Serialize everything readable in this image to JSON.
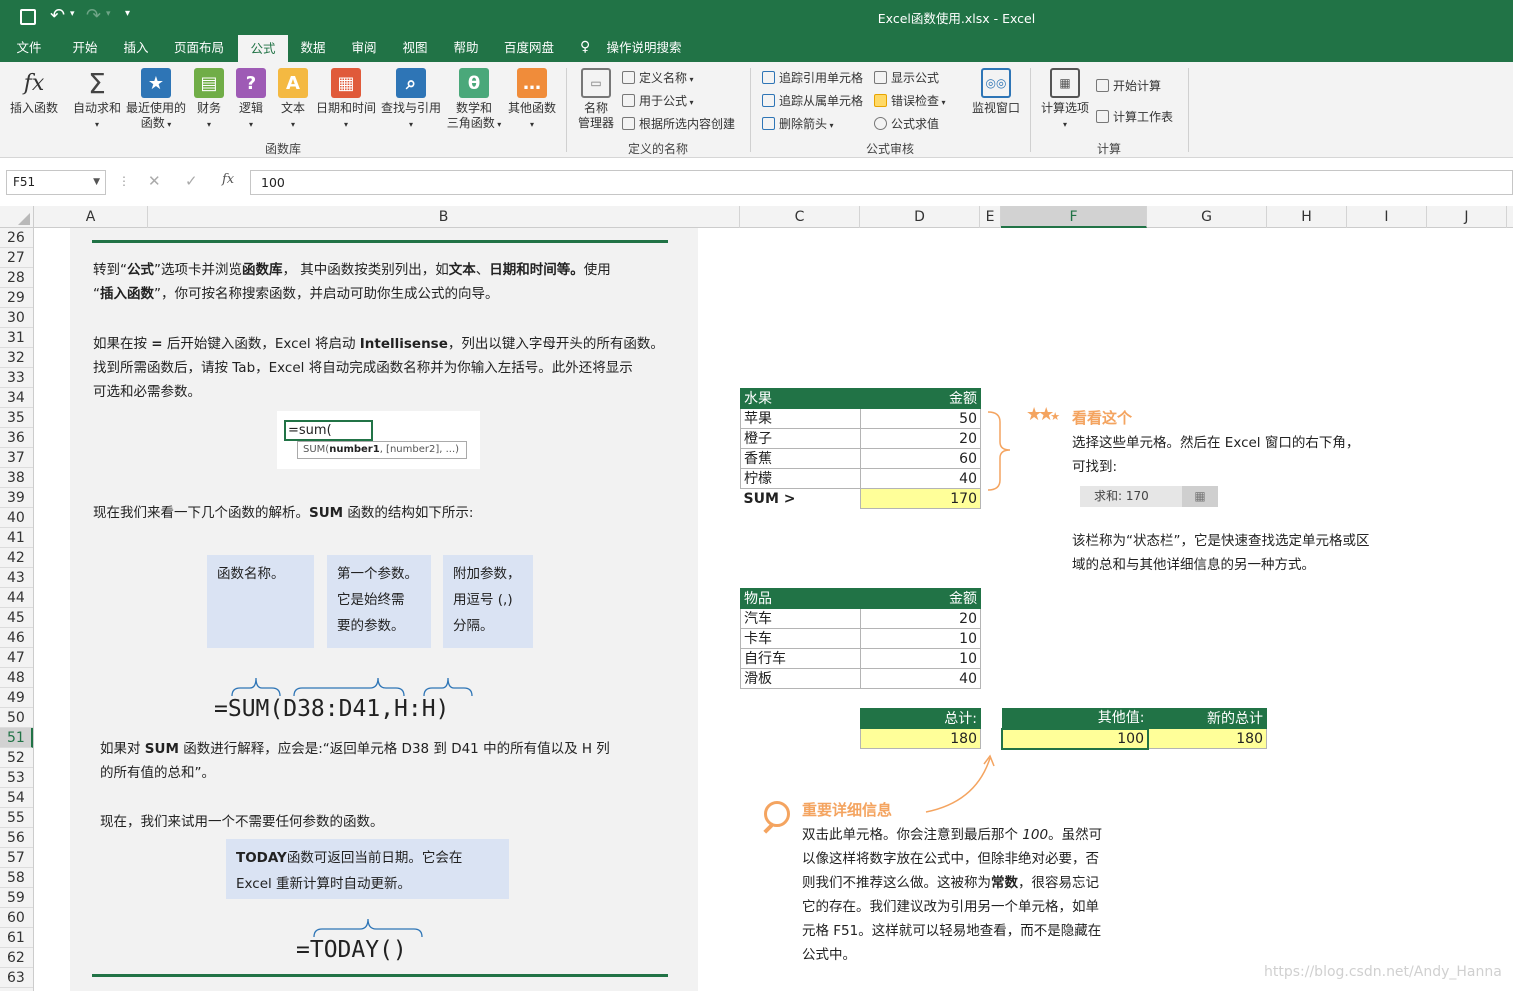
{
  "window": {
    "title": "Excel函数使用.xlsx  -  Excel"
  },
  "tabs": [
    {
      "label": "文件"
    },
    {
      "label": "开始"
    },
    {
      "label": "插入"
    },
    {
      "label": "页面布局"
    },
    {
      "label": "公式"
    },
    {
      "label": "数据"
    },
    {
      "label": "审阅"
    },
    {
      "label": "视图"
    },
    {
      "label": "帮助"
    },
    {
      "label": "百度网盘"
    },
    {
      "label": "操作说明搜索"
    }
  ],
  "ribbon": {
    "insert_function": "插入函数",
    "autosum": "自动求和",
    "recent_1": "最近使用的",
    "recent_2": "函数",
    "finance": "财务",
    "logic": "逻辑",
    "text": "文本",
    "datetime": "日期和时间",
    "lookup": "查找与引用",
    "math_1": "数学和",
    "math_2": "三角函数",
    "other": "其他函数",
    "group_library": "函数库",
    "name_mgr_1": "名称",
    "name_mgr_2": "管理器",
    "define_name": "定义名称",
    "use_in_formula": "用于公式",
    "create_from_sel": "根据所选内容创建",
    "group_names": "定义的名称",
    "trace_prec": "追踪引用单元格",
    "trace_dep": "追踪从属单元格",
    "remove_arrows": "删除箭头",
    "show_formulas": "显示公式",
    "error_check": "错误检查",
    "eval_formula": "公式求值",
    "watch": "监视窗口",
    "group_audit": "公式审核",
    "calc_options": "计算选项",
    "calc_now": "开始计算",
    "calc_sheet": "计算工作表",
    "group_calc": "计算"
  },
  "formula_bar": {
    "name_box": "F51",
    "fx": "fx",
    "value": "100"
  },
  "columns": [
    "A",
    "B",
    "C",
    "D",
    "E",
    "F",
    "G",
    "H",
    "I",
    "J"
  ],
  "rows": [
    "26",
    "27",
    "28",
    "29",
    "30",
    "31",
    "32",
    "33",
    "34",
    "35",
    "36",
    "37",
    "38",
    "39",
    "40",
    "41",
    "42",
    "43",
    "44",
    "45",
    "46",
    "47",
    "48",
    "49",
    "50",
    "51",
    "52",
    "53",
    "54",
    "55",
    "56",
    "57",
    "58",
    "59",
    "60",
    "61",
    "62",
    "63"
  ],
  "left": {
    "p1_a": "转到“",
    "p1_b": "公式",
    "p1_c": "”选项卡并浏览",
    "p1_d": "函数库",
    "p1_e": "，  其中函数按类别列出，如",
    "p1_f": "文本",
    "p1_g": "、",
    "p1_h": "日期和时间等。",
    "p1_i": "使用",
    "p1_j": "“",
    "p1_k": "插入函数",
    "p1_l": "”，你可按名称搜索函数，并启动可助你生成公式的向导。",
    "p2_a": "如果在按 ",
    "p2_b": "=",
    "p2_c": " 后开始键入函数，Excel 将启动 ",
    "p2_d": "Intellisense",
    "p2_e": "，列出以键入字母开头的所有函数。",
    "p2_f": "找到所需函数后，请按 Tab，Excel 将自动完成函数名称并为你输入左括号。此外还将显示",
    "p2_g": "可选和必需参数。",
    "ac_input": "=sum(",
    "ac_tip_a": "SUM(",
    "ac_tip_b": "number1",
    "ac_tip_c": ", [number2], ...)",
    "p3_a": "现在我们来看一下几个函数的解析。",
    "p3_b": "SUM",
    "p3_c": " 函数的结构如下所示:",
    "box1": "函数名称。",
    "box2_1": "第一个参数。",
    "box2_2": "它是始终需",
    "box2_3": "要的参数。",
    "box3_1": "附加参数，",
    "box3_2": "用逗号 (,)",
    "box3_3": "分隔。",
    "sum_formula": "=SUM(D38:D41,H:H)",
    "p4_a": "如果对 ",
    "p4_b": "SUM",
    "p4_c": " 函数进行解释，应会是:“返回单元格 D38 到 D41 中的所有值以及 H 列",
    "p4_d": "的所有值的总和”。",
    "p5": "现在，我们来试用一个不需要任何参数的函数。",
    "today_a": "TODAY",
    "today_b": "函数可返回当前日期。它会在",
    "today_c": "Excel 重新计算时自动更新。",
    "today_formula": "=TODAY()"
  },
  "fruit_table": {
    "header": [
      "水果",
      "金额"
    ],
    "rows": [
      [
        "苹果",
        "50"
      ],
      [
        "橙子",
        "20"
      ],
      [
        "香蕉",
        "60"
      ],
      [
        "柠檬",
        "40"
      ]
    ],
    "sum_label": "SUM >",
    "sum_value": "170"
  },
  "item_table": {
    "header": [
      "物品",
      "金额"
    ],
    "rows": [
      [
        "汽车",
        "20"
      ],
      [
        "卡车",
        "10"
      ],
      [
        "自行车",
        "10"
      ],
      [
        "滑板",
        "40"
      ]
    ]
  },
  "totals": {
    "total_label": "总计:",
    "total_value": "180",
    "other_label": "其他值:",
    "other_value": "100",
    "new_label": "新的总计",
    "new_value": "180"
  },
  "note1": {
    "title": "看看这个",
    "l1": "选择这些单元格。然后在 Excel 窗口的右下角，",
    "l2": "可找到:",
    "status": "求和: 170",
    "l3": "该栏称为“状态栏”，它是快速查找选定单元格或区",
    "l4": "域的总和与其他详细信息的另一种方式。"
  },
  "note2": {
    "title": "重要详细信息",
    "l1a": "双击此单元格。你会注意到最后那个 ",
    "l1b": "100",
    "l1c": "。虽然可",
    "l2": "以像这样将数字放在公式中，但除非绝对必要，否",
    "l3a": "则我们不推荐这么做。这被称为",
    "l3b": "常数",
    "l3c": "，很容易忘记",
    "l4": "它的存在。我们建议改为引用另一个单元格，如单",
    "l5": "元格 F51。这样就可以轻易地查看，而不是隐藏在",
    "l6": "公式中。"
  },
  "watermark": "https://blog.csdn.net/Andy_Hanna",
  "colors": {
    "accent": "#217346",
    "note": "#f4a460",
    "box": "#dae3f3",
    "highlight": "#ffff99"
  }
}
